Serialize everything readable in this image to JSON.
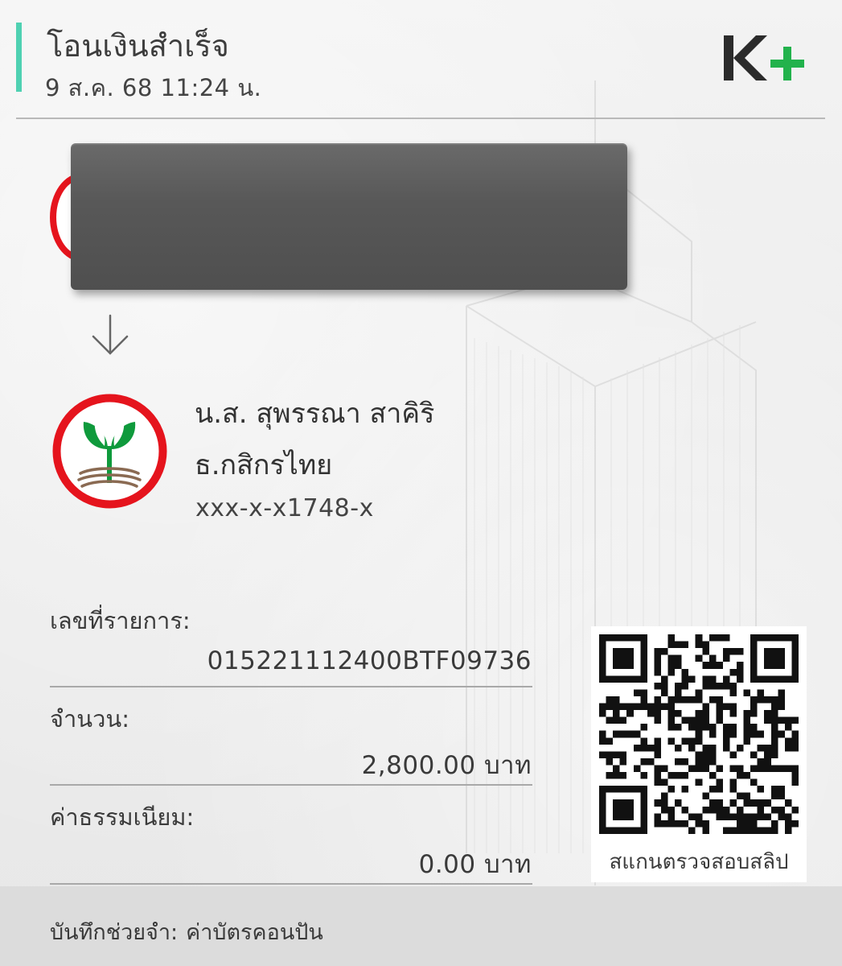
{
  "header": {
    "title": "โอนเงินสำเร็จ",
    "datetime": "9 ส.ค. 68  11:24 น.",
    "logo_text": "K+",
    "accent_color": "#4fd1b2"
  },
  "receiver": {
    "name": "น.ส. สุพรรณา สาคิริ",
    "bank": "ธ.กสิกรไทย",
    "account": "xxx-x-x1748-x",
    "bank_icon": "kbank-logo"
  },
  "transaction": {
    "ref_label": "เลขที่รายการ:",
    "ref_value": "015221112400BTF09736",
    "amount_label": "จำนวน:",
    "amount_value": "2,800.00 บาท",
    "fee_label": "ค่าธรรมเนียม:",
    "fee_value": "0.00 บาท"
  },
  "qr": {
    "caption": "สแกนตรวจสอบสลิป"
  },
  "memo": {
    "label": "บันทึกช่วยจำ:",
    "value": "ค่าบัตรคอนปัน"
  }
}
